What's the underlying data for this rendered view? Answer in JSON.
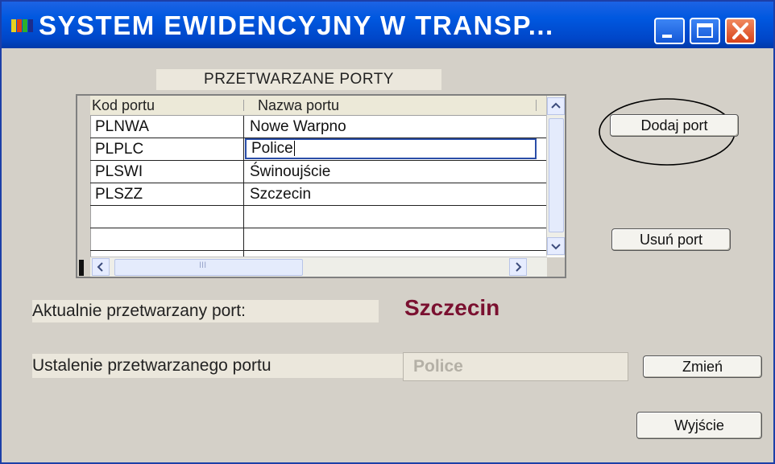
{
  "window": {
    "title": "SYSTEM  EWIDENCYJNY  W  TRANSP..."
  },
  "header_label": "PRZETWARZANE  PORTY",
  "grid": {
    "columns": [
      "Kod portu",
      "Nazwa portu"
    ],
    "rows": [
      {
        "code": "PLNWA",
        "name": "Nowe Warpno"
      },
      {
        "code": "PLPLC",
        "name": "Police"
      },
      {
        "code": "PLSWI",
        "name": "Świnoujście"
      },
      {
        "code": "PLSZZ",
        "name": "Szczecin"
      },
      {
        "code": "",
        "name": ""
      },
      {
        "code": "",
        "name": ""
      }
    ],
    "scroll_mark": "III"
  },
  "buttons": {
    "add": "Dodaj port",
    "remove": "Usuń port",
    "change": "Zmień",
    "exit": "Wyjście"
  },
  "current": {
    "label": "Aktualnie przetwarzany port:",
    "value": "Szczecin"
  },
  "set": {
    "label": "Ustalenie przetwarzanego portu",
    "value": "Police"
  },
  "colors": {
    "titlebar": "#0058e0",
    "current_value": "#7a1030",
    "window_bg": "#d4d0c8"
  },
  "icons": [
    "app-icon",
    "minimize-icon",
    "maximize-icon",
    "close-icon",
    "scroll-up-icon",
    "scroll-down-icon",
    "scroll-left-icon",
    "scroll-right-icon"
  ]
}
